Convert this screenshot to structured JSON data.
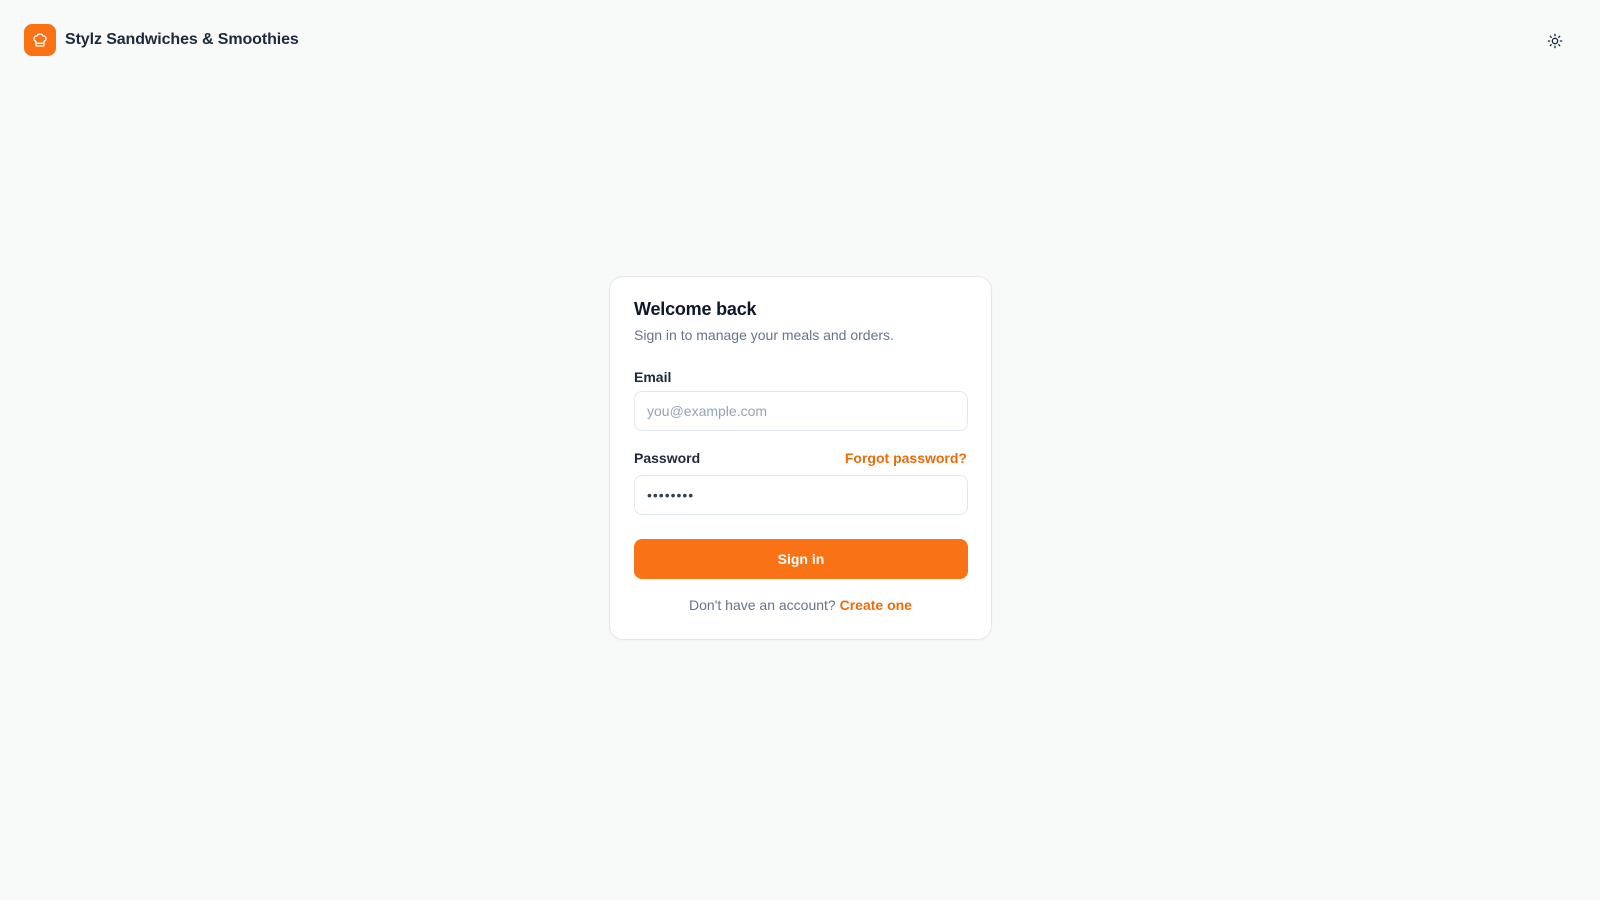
{
  "header": {
    "brand_name": "Stylz Sandwiches & Smoothies",
    "logo_icon": "chef-hat-icon",
    "theme_icon": "sun-icon"
  },
  "login": {
    "title": "Welcome back",
    "subtitle": "Sign in to manage your meals and orders.",
    "email_label": "Email",
    "email_placeholder": "you@example.com",
    "email_value": "",
    "password_label": "Password",
    "password_value": "password",
    "forgot_label": "Forgot password?",
    "submit_label": "Sign in",
    "no_account_text": "Don't have an account?",
    "create_label": "Create one"
  },
  "colors": {
    "accent": "#f97316",
    "accent_text": "#ea6c0a",
    "background": "#f8faf9"
  }
}
